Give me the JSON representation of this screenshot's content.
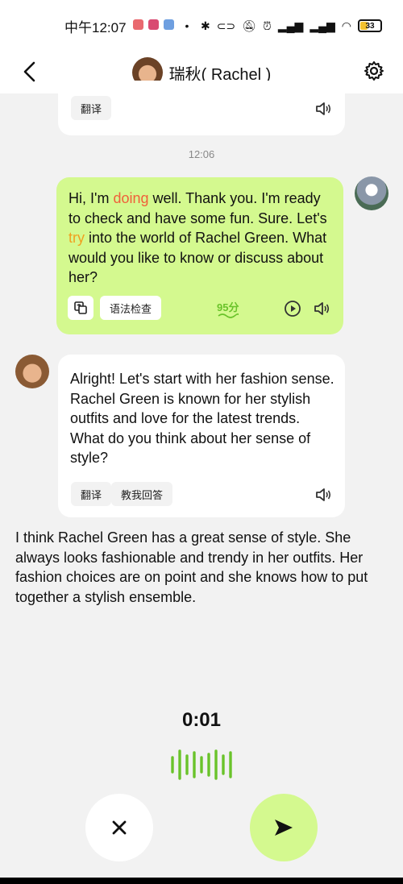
{
  "status_bar": {
    "time": "中午12:07",
    "battery": "33",
    "battery_level": 0.33,
    "icons": [
      "bluetooth-icon",
      "link-icon",
      "mute-icon",
      "alarm-icon",
      "signal-icon",
      "signal-icon",
      "wifi-icon",
      "battery-icon"
    ]
  },
  "header": {
    "title": "瑞秋( Rachel )",
    "back_icon": "chevron-left-icon",
    "settings_icon": "gear-icon"
  },
  "messages": {
    "top_card": {
      "translate_label": "翻译"
    },
    "timestamp": "12:06",
    "user_message": {
      "text_parts": {
        "p1": "Hi, I'm ",
        "p2": "doing",
        "p3": " well. Thank you. I'm ready to check and have some fun. Sure. Let's ",
        "p4": "try",
        "p5": " into the world of Rachel Green. What would you like to know or discuss about her?"
      },
      "grammar_check_label": "语法检查",
      "score": "95分"
    },
    "ai_message": {
      "text": "Alright! Let's start with her fashion sense. Rachel Green is known for her stylish outfits and love for the latest trends. What do you think about her sense of style?",
      "translate_label": "翻译",
      "teach_reply_label": "教我回答"
    }
  },
  "draft": {
    "text": "I think Rachel Green has a great sense of style. She always looks fashionable and trendy in her outfits. Her fashion choices are on point and she knows how to put together a stylish ensemble."
  },
  "recording": {
    "timer": "0:01"
  },
  "colors": {
    "accent_green": "#d4f98f",
    "wave_green": "#6ac32a",
    "highlight_red": "#f0603a",
    "highlight_orange": "#f0a020",
    "background": "#f2f2f2"
  }
}
